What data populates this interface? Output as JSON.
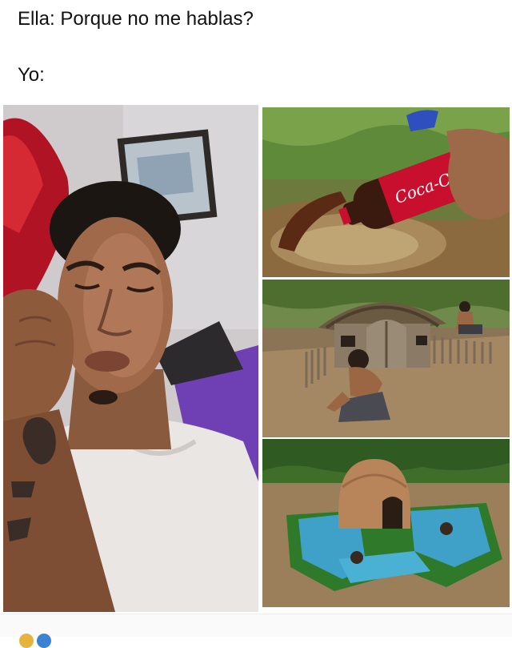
{
  "caption": {
    "line1": "Ella: Porque no me hablas?",
    "line2": "Yo:"
  },
  "images": {
    "top_right": {
      "bottle_label": "Coca-Cola"
    }
  },
  "icons": {
    "reaction_1": "like-reaction-icon",
    "reaction_2": "love-reaction-icon"
  },
  "colors": {
    "background": "#ffffff",
    "text": "#111111",
    "coca_cola_red": "#c8102e"
  }
}
